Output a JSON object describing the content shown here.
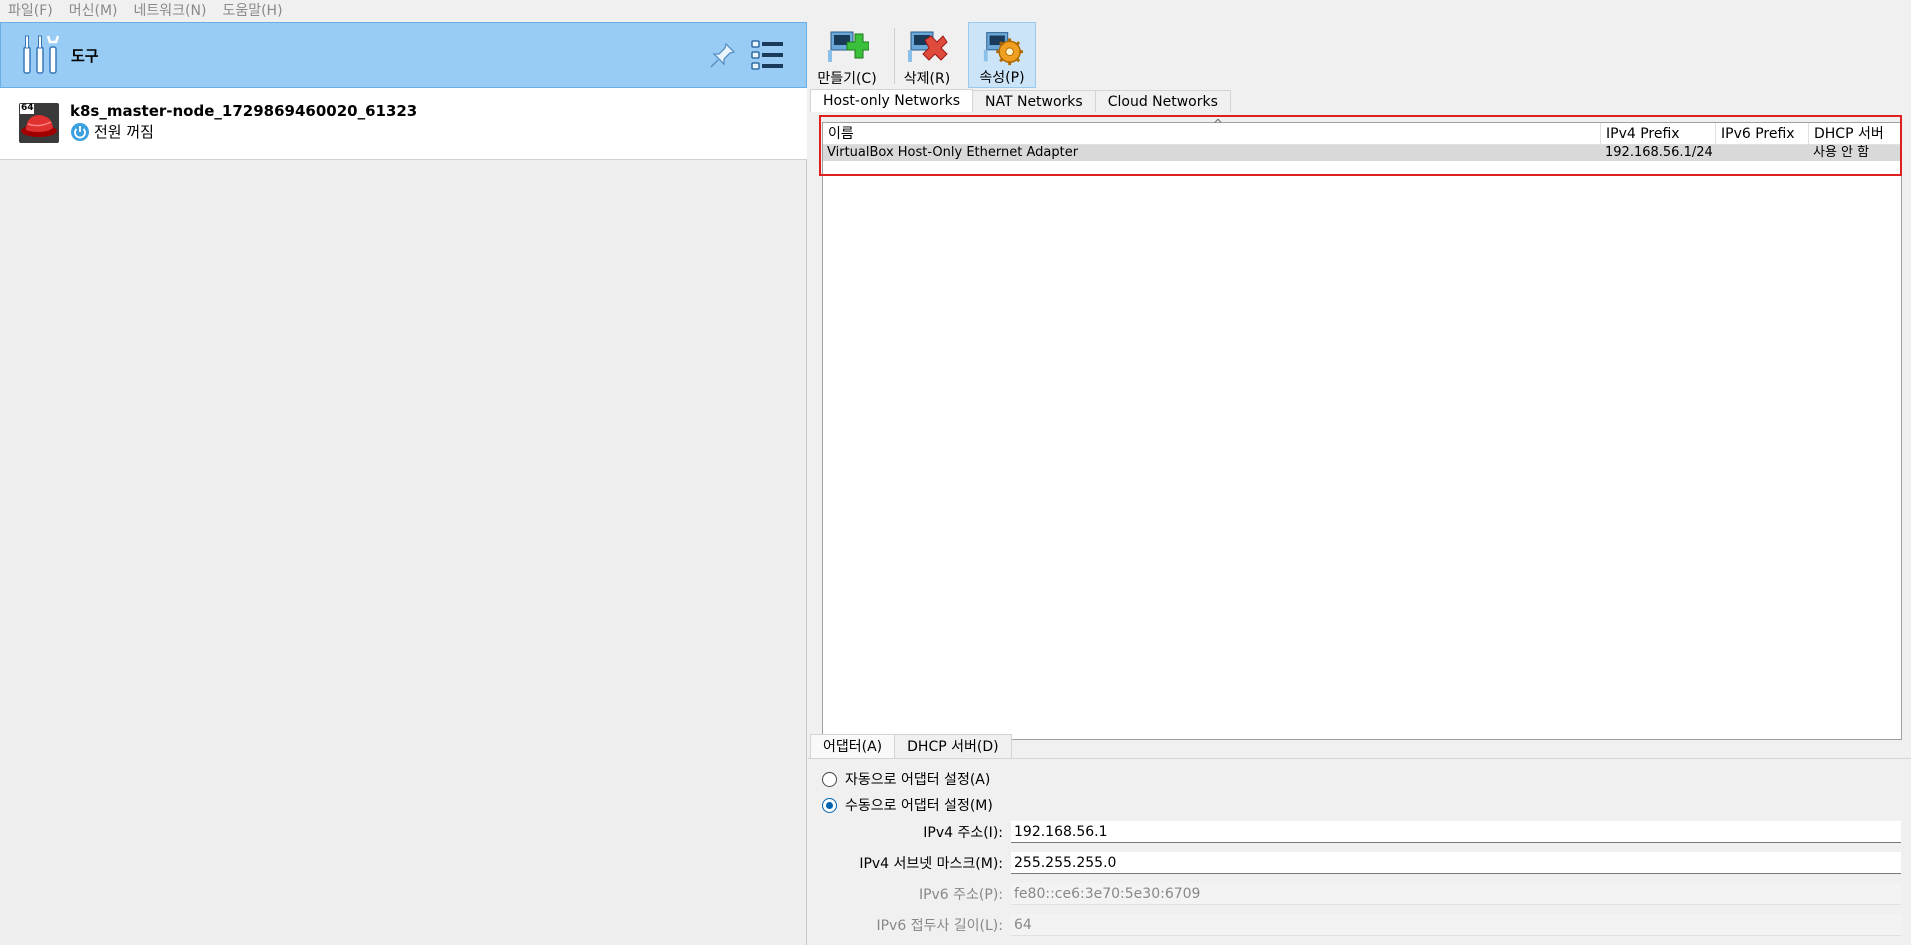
{
  "menubar": {
    "items": [
      "파일(F)",
      "머신(M)",
      "네트워크(N)",
      "도움말(H)"
    ]
  },
  "left": {
    "tools_label": "도구",
    "vm": {
      "name": "k8s_master-node_1729869460020_61323",
      "state": "전원 꺼짐",
      "os_badge": "64"
    }
  },
  "toolbar": {
    "create_label": "만들기(C)",
    "remove_label": "삭제(R)",
    "properties_label": "속성(P)"
  },
  "net_tabs": [
    "Host-only Networks",
    "NAT Networks",
    "Cloud Networks"
  ],
  "table": {
    "columns": [
      "이름",
      "IPv4 Prefix",
      "IPv6 Prefix",
      "DHCP 서버"
    ],
    "rows": [
      {
        "name": "VirtualBox Host-Only Ethernet Adapter",
        "ipv4": "192.168.56.1/24",
        "ipv6": "",
        "dhcp": "사용 안 함"
      }
    ]
  },
  "detail_tabs": [
    "어댑터(A)",
    "DHCP 서버(D)"
  ],
  "adapter": {
    "auto_label": "자동으로 어댑터 설정(A)",
    "manual_label": "수동으로 어댑터 설정(M)",
    "ipv4_address_label": "IPv4 주소(I):",
    "ipv4_address": "192.168.56.1",
    "ipv4_mask_label": "IPv4 서브넷 마스크(M):",
    "ipv4_mask": "255.255.255.0",
    "ipv6_address_label": "IPv6 주소(P):",
    "ipv6_address": "fe80::ce6:3e70:5e30:6709",
    "ipv6_prefix_label": "IPv6 접두사 길이(L):",
    "ipv6_prefix": "64"
  },
  "colors": {
    "selection_bg": "#99ccf5",
    "highlight_box": "#e02020",
    "accent": "#0063b1"
  }
}
